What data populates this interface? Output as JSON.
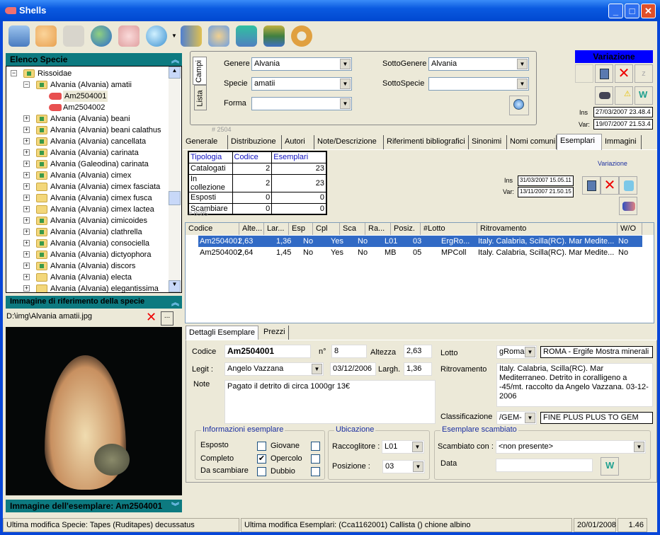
{
  "window": {
    "title": "Shells",
    "minimize": "_",
    "maximize": "□",
    "close": "✕"
  },
  "toolbar": {
    "icons": [
      "cabinet-icon",
      "help-list-icon",
      "portrait-icon",
      "globe-icon",
      "shell-search-icon",
      "globe-search-icon",
      "book-icon",
      "users-icon",
      "word-form-icon",
      "books-icon",
      "gear-icon"
    ]
  },
  "species_panel": {
    "title": "Elenco Specie",
    "tree": [
      {
        "label": "Rissoidae",
        "level": 0,
        "type": "family"
      },
      {
        "label": "Alvania (Alvania) amatii",
        "level": 1,
        "type": "species-green"
      },
      {
        "label": "Am2504001",
        "level": 2,
        "type": "shell"
      },
      {
        "label": "Am2504002",
        "level": 2,
        "type": "shell"
      },
      {
        "label": "Alvania (Alvania) beani",
        "level": 1,
        "type": "species-green"
      },
      {
        "label": "Alvania (Alvania) beani calathus",
        "level": 1,
        "type": "species-green"
      },
      {
        "label": "Alvania (Alvania) cancellata",
        "level": 1,
        "type": "species-green"
      },
      {
        "label": "Alvania (Alvania) carinata",
        "level": 1,
        "type": "species-green"
      },
      {
        "label": "Alvania (Galeodina) carinata",
        "level": 1,
        "type": "species-green"
      },
      {
        "label": "Alvania (Alvania) cimex",
        "level": 1,
        "type": "species-green"
      },
      {
        "label": "Alvania (Alvania) cimex fasciata",
        "level": 1,
        "type": "folder"
      },
      {
        "label": "Alvania (Alvania) cimex fusca",
        "level": 1,
        "type": "folder"
      },
      {
        "label": "Alvania (Alvania) cimex lactea",
        "level": 1,
        "type": "folder"
      },
      {
        "label": "Alvania (Alvania) cimicoides",
        "level": 1,
        "type": "species-green"
      },
      {
        "label": "Alvania (Alvania) clathrella",
        "level": 1,
        "type": "species-green"
      },
      {
        "label": "Alvania (Alvania) consociella",
        "level": 1,
        "type": "species-green"
      },
      {
        "label": "Alvania (Alvania) dictyophora",
        "level": 1,
        "type": "species-green"
      },
      {
        "label": "Alvania (Alvania) discors",
        "level": 1,
        "type": "species-green"
      },
      {
        "label": "Alvania (Alvania) electa",
        "level": 1,
        "type": "folder"
      },
      {
        "label": "Alvania (Alvania) elegantissima",
        "level": 1,
        "type": "folder"
      }
    ]
  },
  "ref_image_panel": {
    "title": "Immagine di riferimento della specie",
    "path": "D:\\img\\Alvania amatii.jpg",
    "browse": "..."
  },
  "specimen_image_panel": {
    "title": "Immagine dell'esemplare: Am2504001"
  },
  "search": {
    "vtabs": [
      "Campi",
      "Lista"
    ],
    "genere_label": "Genere",
    "genere": "Alvania",
    "specie_label": "Specie",
    "specie": "amatii",
    "forma_label": "Forma",
    "forma": "",
    "sottogenere_label": "SottoGenere",
    "sottogenere": "Alvania",
    "sottospecie_label": "SottoSpecie",
    "sottospecie": "",
    "record_id": "# 2504"
  },
  "variazione": {
    "title": "Variazione",
    "ins_label": "Ins",
    "ins": "27/03/2007 23.48.4",
    "var_label": "Var:",
    "var": "19/07/2007 21.53.4"
  },
  "tabs": [
    "Generale",
    "Distribuzione",
    "Autori",
    "Note/Descrizione",
    "Riferimenti bibliografici",
    "Sinonimi",
    "Nomi comuni",
    "Esemplari",
    "Immagini"
  ],
  "active_tab": "Esemplari",
  "summary": {
    "headers": [
      "Tipologia",
      "Codice",
      "Esemplari"
    ],
    "rows": [
      [
        "Catalogati",
        "2",
        "23"
      ],
      [
        "In collezione",
        "2",
        "23"
      ],
      [
        "Esposti",
        "0",
        "0"
      ],
      [
        "Scambiare",
        "0",
        "0"
      ]
    ],
    "record_id": "# 8085"
  },
  "esemplari_variazione": {
    "title": "Variazione",
    "ins_label": "Ins",
    "ins": "31/03/2007 15.05.11",
    "var_label": "Var:",
    "var": "13/11/2007 21.50.15"
  },
  "list": {
    "headers": [
      "Codice",
      "Alte...",
      "Lar...",
      "Esp",
      "Cpl",
      "Sca",
      "Ra...",
      "Posiz.",
      "#Lotto",
      "Ritrovamento",
      "W/O"
    ],
    "rows": [
      [
        "Am2504001",
        "2,63",
        "1,36",
        "No",
        "Yes",
        "No",
        "L01",
        "03",
        "ErgRo...",
        "Italy. Calabria, Scilla(RC). Mar Medite...",
        "No"
      ],
      [
        "Am2504002",
        "2,64",
        "1,45",
        "No",
        "Yes",
        "No",
        "MB",
        "05",
        "MPColl",
        "Italy. Calabria, Scilla(RC). Mar Medite...",
        "No"
      ]
    ],
    "selected": 0
  },
  "details": {
    "tabs": [
      "Dettagli Esemplare",
      "Prezzi"
    ],
    "codice_label": "Codice",
    "codice": "Am2504001",
    "n_label": "n°",
    "n": "8",
    "altezza_label": "Altezza",
    "altezza": "2,63",
    "legit_label": "Legit :",
    "legit": "Angelo Vazzana",
    "data": "03/12/2006",
    "largh_label": "Largh.",
    "largh": "1,36",
    "note_label": "Note",
    "note": "Pagato il detrito di circa 1000gr 13€",
    "lotto_label": "Lotto",
    "lotto_code": "gRoma",
    "lotto_desc": "ROMA - Ergife Mostra minerali",
    "ritrovamento_label": "Ritrovamento",
    "ritrovamento": "Italy. Calabria, Scilla(RC). Mar Mediterraneo. Detrito in coralligeno a  -45/mt. raccolto da Angelo Vazzana. 03-12-2006",
    "classificazione_label": "Classificazione",
    "class_code": "/GEM-",
    "class_desc": "FINE PLUS PLUS TO GEM",
    "info": {
      "title": "Informazioni esemplare",
      "esposto": "Esposto",
      "completo": "Completo",
      "da_scambiare": "Da scambiare",
      "giovane": "Giovane",
      "opercolo": "Opercolo",
      "dubbio": "Dubbio",
      "checks": {
        "esposto": false,
        "completo": true,
        "da_scambiare": false,
        "giovane": false,
        "opercolo": false,
        "dubbio": false
      },
      "check_mark": "✔"
    },
    "ubicazione": {
      "title": "Ubicazione",
      "raccoglitore_label": "Raccoglitore :",
      "raccoglitore": "L01",
      "posizione_label": "Posizione :",
      "posizione": "03"
    },
    "scambiato": {
      "title": "Esemplare scambiato",
      "con_label": "Scambiato con :",
      "con": "<non presente>",
      "data_label": "Data",
      "data": ""
    }
  },
  "statusbar": {
    "specie": "Ultima modifica Specie: Tapes  (Ruditapes) decussatus",
    "esemplari": "Ultima modifica Esemplari: (Cca1162001) Callista  () chione  albino",
    "date": "20/01/2008",
    "version": "1.46"
  }
}
